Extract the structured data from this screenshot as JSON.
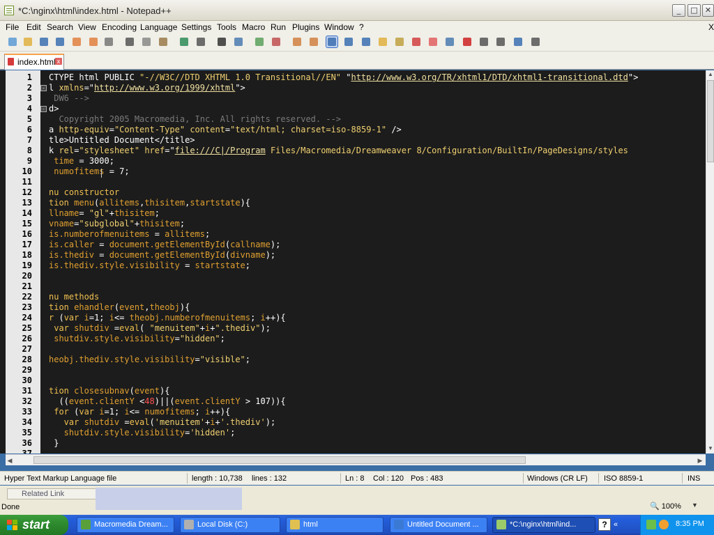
{
  "window": {
    "title": "*C:\\nginx\\html\\index.html - Notepad++",
    "buttons": [
      "_",
      "□",
      "✕"
    ]
  },
  "menu": [
    "File",
    "Edit",
    "Search",
    "View",
    "Encoding",
    "Language",
    "Settings",
    "Tools",
    "Macro",
    "Run",
    "Plugins",
    "Window",
    "?"
  ],
  "menu_right_close": "X",
  "toolbar_icons": [
    {
      "name": "new-file-icon",
      "color": "#5a9bd5"
    },
    {
      "name": "open-file-icon",
      "color": "#e0b040"
    },
    {
      "name": "save-icon",
      "color": "#3a6fb0"
    },
    {
      "name": "save-all-icon",
      "color": "#3a6fb0"
    },
    {
      "name": "close-icon",
      "color": "#e08040"
    },
    {
      "name": "close-all-icon",
      "color": "#e08040"
    },
    {
      "name": "print-icon",
      "color": "#777777"
    },
    {
      "name": "cut-icon",
      "color": "#555555"
    },
    {
      "name": "copy-icon",
      "color": "#888888"
    },
    {
      "name": "paste-icon",
      "color": "#9a7a4a"
    },
    {
      "name": "undo-icon",
      "color": "#2e8b57"
    },
    {
      "name": "redo-icon",
      "color": "#555555"
    },
    {
      "name": "find-icon",
      "color": "#333333"
    },
    {
      "name": "replace-icon",
      "color": "#4a7ab0"
    },
    {
      "name": "zoom-in-icon",
      "color": "#5aa05a"
    },
    {
      "name": "zoom-out-icon",
      "color": "#c05050"
    },
    {
      "name": "sync-vertical-icon",
      "color": "#d08040"
    },
    {
      "name": "sync-horizontal-icon",
      "color": "#d08040"
    },
    {
      "name": "word-wrap-icon",
      "color": "#3a6fb0"
    },
    {
      "name": "show-all-chars-icon",
      "color": "#3a6fb0"
    },
    {
      "name": "indent-guide-icon",
      "color": "#3a6fb0"
    },
    {
      "name": "user-language-icon",
      "color": "#e0b040"
    },
    {
      "name": "doc-map-icon",
      "color": "#c0a040"
    },
    {
      "name": "function-list-icon",
      "color": "#d04040"
    },
    {
      "name": "folder-as-workspace-icon",
      "color": "#e06060"
    },
    {
      "name": "monitoring-icon",
      "color": "#4a7ab0"
    },
    {
      "name": "record-macro-icon",
      "color": "#cc2222"
    },
    {
      "name": "stop-macro-icon",
      "color": "#555555"
    },
    {
      "name": "play-macro-icon",
      "color": "#555555"
    },
    {
      "name": "run-macro-multiple-icon",
      "color": "#3a6fb0"
    },
    {
      "name": "save-macro-icon",
      "color": "#555555"
    }
  ],
  "tab": {
    "label": "index.html"
  },
  "editor": {
    "lines": [
      {
        "n": "1",
        "fold": "",
        "parts": [
          [
            "c-tag",
            "CTYPE html PUBLIC "
          ],
          [
            "c-str",
            "\"-//W3C//DTD XHTML 1.0 Transitional//EN\""
          ],
          [
            "c-tag",
            " \""
          ],
          [
            "c-url",
            "http://www.w3.org/TR/xhtml1/DTD/xhtml1-transitional.dtd"
          ],
          [
            "c-tag",
            "\">"
          ]
        ]
      },
      {
        "n": "2",
        "fold": "⊟",
        "parts": [
          [
            "c-tag",
            "l "
          ],
          [
            "c-attr",
            "xmlns"
          ],
          [
            "c-tag",
            "=\""
          ],
          [
            "c-url",
            "http://www.w3.org/1999/xhtml"
          ],
          [
            "c-tag",
            "\">"
          ]
        ]
      },
      {
        "n": "3",
        "fold": "",
        "parts": [
          [
            "c-com",
            " DW6 -->"
          ]
        ]
      },
      {
        "n": "4",
        "fold": "⊟",
        "parts": [
          [
            "c-tag",
            "d>"
          ]
        ]
      },
      {
        "n": "5",
        "fold": "",
        "parts": [
          [
            "c-com",
            "  Copyright 2005 Macromedia, Inc. All rights reserved. -->"
          ]
        ]
      },
      {
        "n": "6",
        "fold": "",
        "parts": [
          [
            "c-tag",
            "a "
          ],
          [
            "c-attr",
            "http-equiv"
          ],
          [
            "c-tag",
            "="
          ],
          [
            "c-str",
            "\"Content-Type\""
          ],
          [
            "c-tag",
            " "
          ],
          [
            "c-attr",
            "content"
          ],
          [
            "c-tag",
            "="
          ],
          [
            "c-str",
            "\"text/html; charset=iso-8859-1\""
          ],
          [
            "c-tag",
            " />"
          ]
        ]
      },
      {
        "n": "7",
        "fold": "",
        "parts": [
          [
            "c-tag",
            "tle>"
          ],
          [
            "c-txt",
            "Untitled Document"
          ],
          [
            "c-tag",
            "</title>"
          ]
        ]
      },
      {
        "n": "8",
        "fold": "",
        "parts": [
          [
            "c-tag",
            "k "
          ],
          [
            "c-attr",
            "rel"
          ],
          [
            "c-tag",
            "="
          ],
          [
            "c-str",
            "\"stylesheet\""
          ],
          [
            "c-tag",
            " "
          ],
          [
            "c-attr",
            "href"
          ],
          [
            "c-tag",
            "=\""
          ],
          [
            "c-url",
            "file:///C|/Program"
          ],
          [
            "c-str",
            " Files/Macromedia/Dreamweaver 8/Configuration/BuiltIn/PageDesigns/styles"
          ]
        ]
      },
      {
        "n": "9",
        "fold": "",
        "parts": [
          [
            "c-id",
            " time "
          ],
          [
            "c-op",
            "= "
          ],
          [
            "c-num",
            "3000"
          ],
          [
            "c-op",
            ";"
          ]
        ]
      },
      {
        "n": "10",
        "fold": "",
        "parts": [
          [
            "c-id",
            " numofitems "
          ],
          [
            "c-op",
            "= "
          ],
          [
            "c-num",
            "7"
          ],
          [
            "c-op",
            ";"
          ]
        ]
      },
      {
        "n": "11",
        "fold": "",
        "parts": [
          [
            "c-tag",
            ""
          ]
        ]
      },
      {
        "n": "12",
        "fold": "",
        "parts": [
          [
            "c-kw",
            "nu constructor"
          ]
        ]
      },
      {
        "n": "13",
        "fold": "",
        "parts": [
          [
            "c-kw",
            "tion "
          ],
          [
            "c-id",
            "menu"
          ],
          [
            "c-op",
            "("
          ],
          [
            "c-id",
            "allitems"
          ],
          [
            "c-op",
            ","
          ],
          [
            "c-id",
            "thisitem"
          ],
          [
            "c-op",
            ","
          ],
          [
            "c-id",
            "startstate"
          ],
          [
            "c-op",
            "){"
          ]
        ]
      },
      {
        "n": "14",
        "fold": "",
        "parts": [
          [
            "c-id",
            "llname"
          ],
          [
            "c-op",
            "= "
          ],
          [
            "c-str",
            "\"gl\""
          ],
          [
            "c-op",
            "+"
          ],
          [
            "c-id",
            "thisitem"
          ],
          [
            "c-op",
            ";"
          ]
        ]
      },
      {
        "n": "15",
        "fold": "",
        "parts": [
          [
            "c-id",
            "vname"
          ],
          [
            "c-op",
            "="
          ],
          [
            "c-str",
            "\"subglobal\""
          ],
          [
            "c-op",
            "+"
          ],
          [
            "c-id",
            "thisitem"
          ],
          [
            "c-op",
            ";"
          ]
        ]
      },
      {
        "n": "16",
        "fold": "",
        "parts": [
          [
            "c-id",
            "is.numberofmenuitems "
          ],
          [
            "c-op",
            "= "
          ],
          [
            "c-id",
            "allitems"
          ],
          [
            "c-op",
            ";"
          ]
        ]
      },
      {
        "n": "17",
        "fold": "",
        "parts": [
          [
            "c-id",
            "is.caller "
          ],
          [
            "c-op",
            "= "
          ],
          [
            "c-id",
            "document.getElementById"
          ],
          [
            "c-op",
            "("
          ],
          [
            "c-id",
            "callname"
          ],
          [
            "c-op",
            ");"
          ]
        ]
      },
      {
        "n": "18",
        "fold": "",
        "parts": [
          [
            "c-id",
            "is.thediv "
          ],
          [
            "c-op",
            "= "
          ],
          [
            "c-id",
            "document.getElementById"
          ],
          [
            "c-op",
            "("
          ],
          [
            "c-id",
            "divname"
          ],
          [
            "c-op",
            ");"
          ]
        ]
      },
      {
        "n": "19",
        "fold": "",
        "parts": [
          [
            "c-id",
            "is.thediv.style.visibility "
          ],
          [
            "c-op",
            "= "
          ],
          [
            "c-id",
            "startstate"
          ],
          [
            "c-op",
            ";"
          ]
        ]
      },
      {
        "n": "20",
        "fold": "",
        "parts": [
          [
            "c-tag",
            ""
          ]
        ]
      },
      {
        "n": "21",
        "fold": "",
        "parts": [
          [
            "c-tag",
            ""
          ]
        ]
      },
      {
        "n": "22",
        "fold": "",
        "parts": [
          [
            "c-kw",
            "nu methods"
          ]
        ]
      },
      {
        "n": "23",
        "fold": "",
        "parts": [
          [
            "c-kw",
            "tion "
          ],
          [
            "c-id",
            "ehandler"
          ],
          [
            "c-op",
            "("
          ],
          [
            "c-id",
            "event"
          ],
          [
            "c-op",
            ","
          ],
          [
            "c-id",
            "theobj"
          ],
          [
            "c-op",
            "){"
          ]
        ]
      },
      {
        "n": "24",
        "fold": "",
        "parts": [
          [
            "c-kw",
            "r "
          ],
          [
            "c-op",
            "("
          ],
          [
            "c-kw",
            "var "
          ],
          [
            "c-id",
            "i"
          ],
          [
            "c-op",
            "="
          ],
          [
            "c-num",
            "1"
          ],
          [
            "c-op",
            "; "
          ],
          [
            "c-id",
            "i"
          ],
          [
            "c-op",
            "<= "
          ],
          [
            "c-id",
            "theobj.numberofmenuitems"
          ],
          [
            "c-op",
            "; "
          ],
          [
            "c-id",
            "i"
          ],
          [
            "c-op",
            "++){"
          ]
        ]
      },
      {
        "n": "25",
        "fold": "",
        "parts": [
          [
            "c-kw",
            " var "
          ],
          [
            "c-id",
            "shutdiv "
          ],
          [
            "c-op",
            "="
          ],
          [
            "c-kw",
            "eval"
          ],
          [
            "c-op",
            "( "
          ],
          [
            "c-str",
            "\"menuitem\""
          ],
          [
            "c-op",
            "+"
          ],
          [
            "c-id",
            "i"
          ],
          [
            "c-op",
            "+"
          ],
          [
            "c-str",
            "\".thediv\""
          ],
          [
            "c-op",
            ");"
          ]
        ]
      },
      {
        "n": "26",
        "fold": "",
        "parts": [
          [
            "c-id",
            " shutdiv.style.visibility"
          ],
          [
            "c-op",
            "="
          ],
          [
            "c-str",
            "\"hidden\""
          ],
          [
            "c-op",
            ";"
          ]
        ]
      },
      {
        "n": "27",
        "fold": "",
        "parts": [
          [
            "c-tag",
            ""
          ]
        ]
      },
      {
        "n": "28",
        "fold": "",
        "parts": [
          [
            "c-id",
            "heobj.thediv.style.visibility"
          ],
          [
            "c-op",
            "="
          ],
          [
            "c-str",
            "\"visible\""
          ],
          [
            "c-op",
            ";"
          ]
        ]
      },
      {
        "n": "29",
        "fold": "",
        "parts": [
          [
            "c-tag",
            ""
          ]
        ]
      },
      {
        "n": "30",
        "fold": "",
        "parts": [
          [
            "c-tag",
            ""
          ]
        ]
      },
      {
        "n": "31",
        "fold": "",
        "parts": [
          [
            "c-kw",
            "tion "
          ],
          [
            "c-id",
            "closesubnav"
          ],
          [
            "c-op",
            "("
          ],
          [
            "c-id",
            "event"
          ],
          [
            "c-op",
            "){"
          ]
        ]
      },
      {
        "n": "32",
        "fold": "",
        "parts": [
          [
            "c-op",
            "  (("
          ],
          [
            "c-id",
            "event.clientY "
          ],
          [
            "c-op",
            "<"
          ],
          [
            "c-red",
            "48"
          ],
          [
            "c-op",
            ")||("
          ],
          [
            "c-id",
            "event.clientY "
          ],
          [
            "c-op",
            "> "
          ],
          [
            "c-num",
            "107"
          ],
          [
            "c-op",
            ")){"
          ]
        ]
      },
      {
        "n": "33",
        "fold": "",
        "parts": [
          [
            "c-kw",
            " for "
          ],
          [
            "c-op",
            "("
          ],
          [
            "c-kw",
            "var "
          ],
          [
            "c-id",
            "i"
          ],
          [
            "c-op",
            "="
          ],
          [
            "c-num",
            "1"
          ],
          [
            "c-op",
            "; "
          ],
          [
            "c-id",
            "i"
          ],
          [
            "c-op",
            "<= "
          ],
          [
            "c-id",
            "numofitems"
          ],
          [
            "c-op",
            "; "
          ],
          [
            "c-id",
            "i"
          ],
          [
            "c-op",
            "++){"
          ]
        ]
      },
      {
        "n": "34",
        "fold": "",
        "parts": [
          [
            "c-kw",
            "   var "
          ],
          [
            "c-id",
            "shutdiv "
          ],
          [
            "c-op",
            "="
          ],
          [
            "c-kw",
            "eval"
          ],
          [
            "c-op",
            "("
          ],
          [
            "c-str",
            "'menuitem'"
          ],
          [
            "c-op",
            "+"
          ],
          [
            "c-id",
            "i"
          ],
          [
            "c-op",
            "+"
          ],
          [
            "c-str",
            "'.thediv'"
          ],
          [
            "c-op",
            ");"
          ]
        ]
      },
      {
        "n": "35",
        "fold": "",
        "parts": [
          [
            "c-id",
            "   shutdiv.style.visibility"
          ],
          [
            "c-op",
            "="
          ],
          [
            "c-str",
            "'hidden'"
          ],
          [
            "c-op",
            ";"
          ]
        ]
      },
      {
        "n": "36",
        "fold": "",
        "parts": [
          [
            "c-op",
            " }"
          ]
        ]
      },
      {
        "n": "37",
        "fold": "",
        "parts": [
          [
            "c-tag",
            ""
          ]
        ]
      }
    ]
  },
  "status": {
    "file_type": "Hyper Text Markup Language file",
    "length": "length : 10,738",
    "lines": "lines : 132",
    "ln": "Ln : 8",
    "col": "Col : 120",
    "pos": "Pos : 483",
    "eol": "Windows (CR LF)",
    "encoding": "ISO 8859-1",
    "mode": "INS"
  },
  "browser": {
    "related_link": "Related Link",
    "status": "Done",
    "zoom": "100%"
  },
  "taskbar": {
    "start": "start",
    "tasks": [
      {
        "label": "Macromedia Dream...",
        "icon_color": "#5aa03a",
        "active": false
      },
      {
        "label": "Local Disk (C:)",
        "icon_color": "#b0b0b0",
        "active": false
      },
      {
        "label": "html",
        "icon_color": "#e0c050",
        "active": false
      },
      {
        "label": "Untitled Document ...",
        "icon_color": "#3a7ad5",
        "active": false
      },
      {
        "label": "*C:\\nginx\\html\\ind...",
        "icon_color": "#9aca6a",
        "active": true
      }
    ],
    "help": "?",
    "clock": "8:35 PM"
  }
}
